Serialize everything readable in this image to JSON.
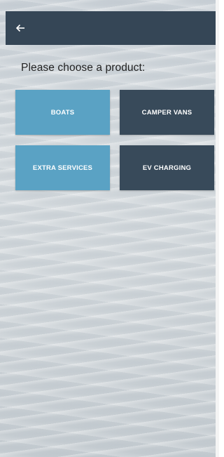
{
  "header": {
    "back_icon": "arrow-left-icon"
  },
  "prompt": "Please choose a product:",
  "products": [
    {
      "label": "BOATS",
      "color": "#5aa2c4"
    },
    {
      "label": "CAMPER VANS",
      "color": "#384a5a"
    },
    {
      "label": "EXTRA SERVICES",
      "color": "#5aa2c4"
    },
    {
      "label": "EV CHARGING",
      "color": "#384a5a"
    }
  ],
  "colors": {
    "appbar": "#354656",
    "accent_blue": "#5aa2c4",
    "dark_tile": "#384a5a"
  }
}
